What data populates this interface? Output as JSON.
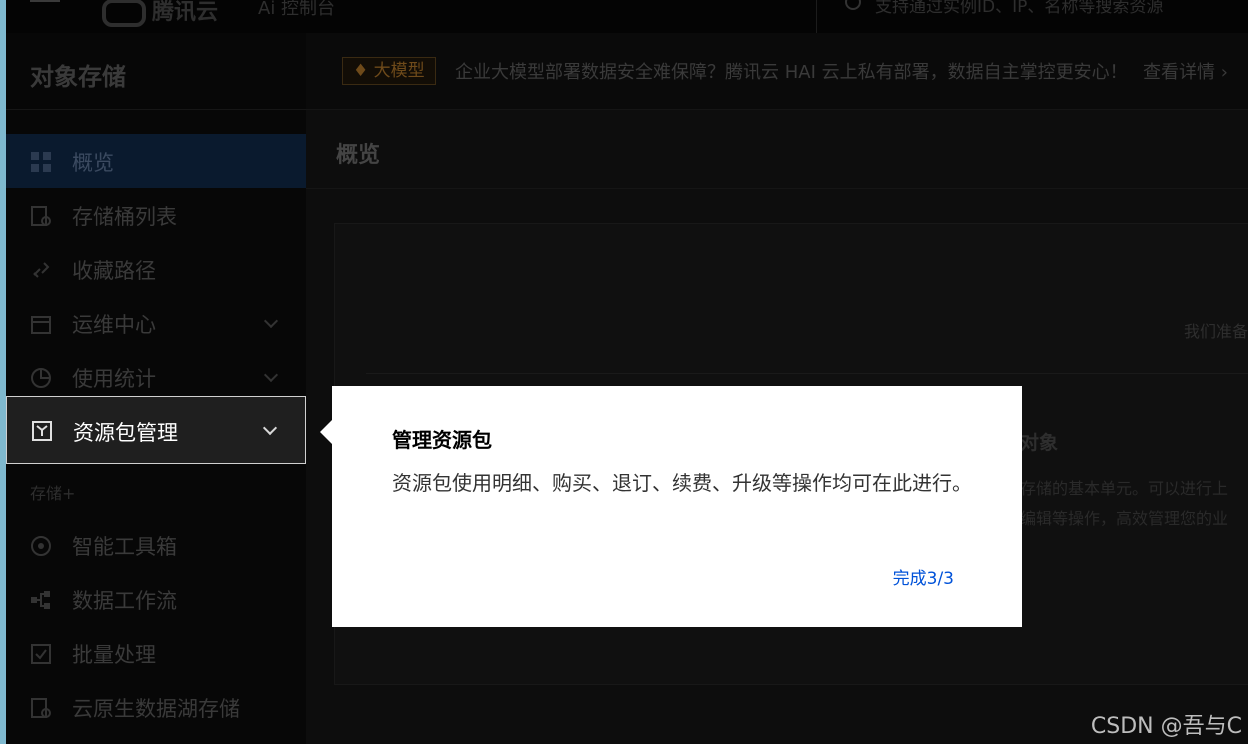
{
  "topbar": {
    "logo_text": "腾讯云",
    "console_text": "Ai 控制台",
    "search_placeholder": "支持通过实例ID、IP、名称等搜索资源"
  },
  "sidebar": {
    "title": "对象存储",
    "items": [
      {
        "label": "概览",
        "icon": "overview-grid-icon"
      },
      {
        "label": "存储桶列表",
        "icon": "bucket-list-icon"
      },
      {
        "label": "收藏路径",
        "icon": "link-icon"
      },
      {
        "label": "运维中心",
        "icon": "calendar-icon",
        "has_chevron": true
      },
      {
        "label": "使用统计",
        "icon": "pie-chart-icon",
        "has_chevron": true
      },
      {
        "label": "资源包管理",
        "icon": "package-icon",
        "has_chevron": true
      },
      {
        "label": "智能工具箱",
        "icon": "toolbox-icon"
      },
      {
        "label": "数据工作流",
        "icon": "workflow-icon"
      },
      {
        "label": "批量处理",
        "icon": "batch-icon"
      },
      {
        "label": "云原生数据湖存储",
        "icon": "datalake-icon"
      }
    ],
    "section_label": "存储+"
  },
  "banner": {
    "badge": "大模型",
    "text": "企业大模型部署数据安全难保障？腾讯云 HAI 云上私有部署，数据自主掌控更安心！",
    "link": "查看详情"
  },
  "main": {
    "page_title": "概览",
    "card_hint": "我们准备",
    "object_title": "对象",
    "object_desc_line1": "存储的基本单元。可以进行上",
    "object_desc_line2": "编辑等操作，高效管理您的业"
  },
  "popover": {
    "title": "管理资源包",
    "body": "资源包使用明细、购买、退订、续费、升级等操作均可在此进行。",
    "done_label": "完成3/3"
  },
  "watermark": "CSDN @吾与C",
  "colors": {
    "accent": "#0052d9",
    "badge_text": "#6e4a1a"
  }
}
